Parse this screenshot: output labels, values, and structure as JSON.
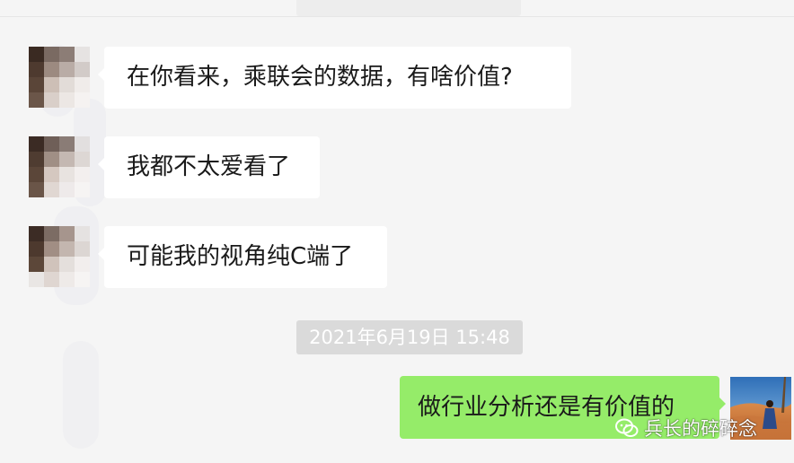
{
  "messages_in": [
    {
      "text": "在你看来，乘联会的数据，有啥价值?"
    },
    {
      "text": "我都不太爱看了"
    },
    {
      "text": "可能我的视角纯C端了"
    }
  ],
  "timestamp": "2021年6月19日 15:48",
  "message_out": {
    "text": "做行业分析还是有价值的"
  },
  "watermark": {
    "text": "兵长的碎碎念"
  },
  "colors": {
    "background": "#f5f5f5",
    "incoming_bubble": "#ffffff",
    "outgoing_bubble": "#95ec69",
    "timestamp_bg": "#dadada"
  }
}
